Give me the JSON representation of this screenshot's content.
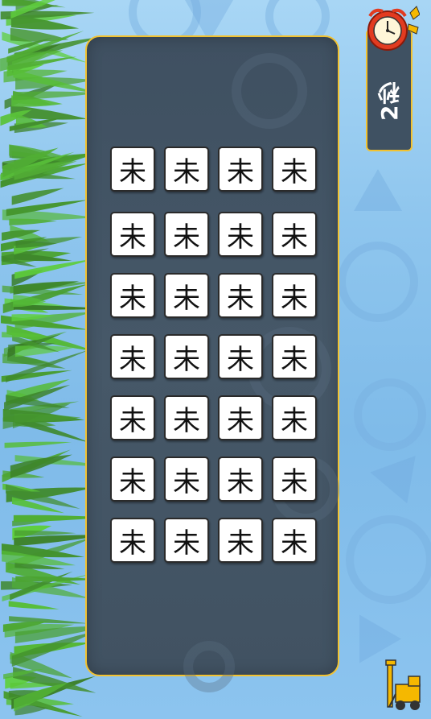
{
  "timer": {
    "label": "2秒"
  },
  "board": {
    "tile_char": "未",
    "rows": 7,
    "cols": 4
  },
  "icons": {
    "clock": "alarm-clock-icon",
    "tool": "construction-vehicle-icon"
  },
  "colors": {
    "board_bg": "#435566",
    "board_border": "#f2c230",
    "tile_bg": "#ffffff",
    "sky": "#8fc6ee"
  }
}
